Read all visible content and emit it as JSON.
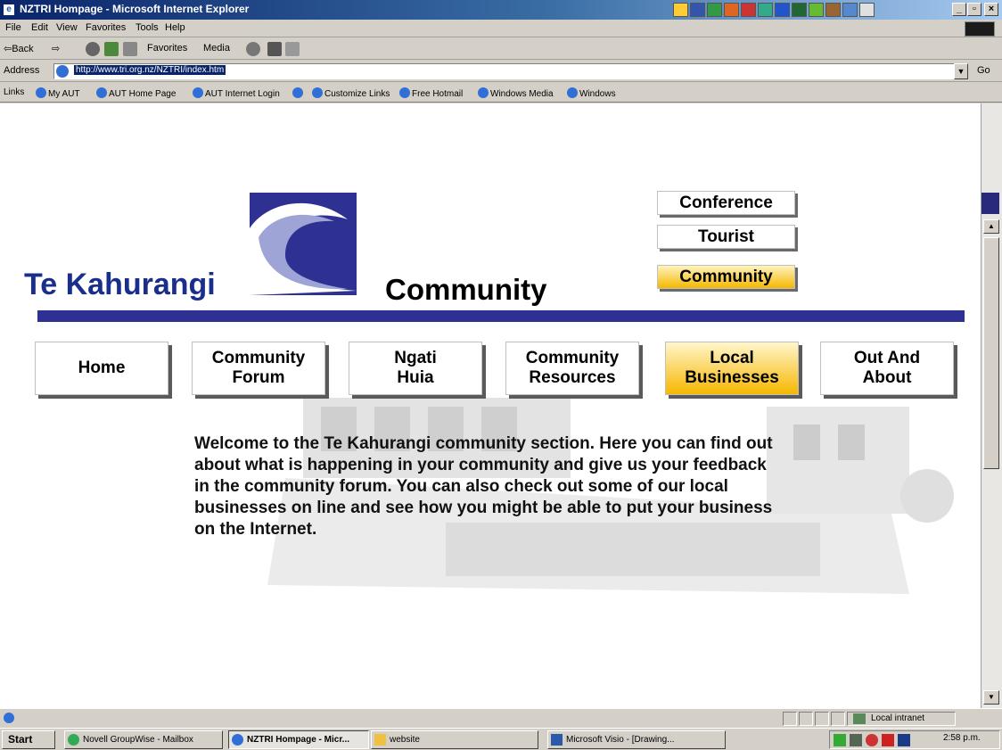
{
  "window": {
    "title": "NZTRI Hompage - Microsoft Internet Explorer",
    "title_icon": "e",
    "minimize": "_",
    "maximize": "▫",
    "close": "×"
  },
  "menu": [
    "File",
    "Edit",
    "View",
    "Favorites",
    "Tools",
    "Help"
  ],
  "toolbar": {
    "back": "⇦Back",
    "forward": "⇨",
    "favorites": "Favorites",
    "media": "Media"
  },
  "address": {
    "label": "Address",
    "url": "http://www.tri.org.nz/NZTRI/index.htm",
    "go": "Go",
    "dropdown": "▼"
  },
  "links": {
    "label": "Links",
    "items": [
      "My AUT",
      "AUT Home Page",
      "AUT Internet Login",
      "Customize Links",
      "Free Hotmail",
      "Windows Media",
      "Windows"
    ]
  },
  "page": {
    "brand": "Te Kahurangi",
    "section_title": "Community",
    "top_nav": [
      {
        "label": "Conference",
        "active": false
      },
      {
        "label": "Tourist",
        "active": false
      },
      {
        "label": "Community",
        "active": true
      }
    ],
    "main_nav": [
      {
        "label": "Home",
        "active": false
      },
      {
        "label": "Community Forum",
        "active": false
      },
      {
        "label": "Ngati Huia",
        "active": false
      },
      {
        "label": "Community Resources",
        "active": false
      },
      {
        "label": "Local Businesses",
        "active": true
      },
      {
        "label": "Out And About",
        "active": false
      }
    ],
    "welcome_text": "Welcome to the Te Kahurangi community section. Here you can find out about what is happening in your community and give us your feedback in the community forum. You can also check out some of our local businesses on  line and see how you might be able to put your business on the Internet."
  },
  "statusbar": {
    "zone": "Local intranet"
  },
  "taskbar": {
    "start": "Start",
    "tasks": [
      "Novell GroupWise - Mailbox",
      "NZTRI Hompage - Micr...",
      "website",
      "Microsoft Visio - [Drawing..."
    ],
    "clock": "2:58 p.m."
  },
  "colors": {
    "brand_blue": "#1a2f8c",
    "divider_blue": "#2e3192",
    "active_gold": "#f5b800"
  }
}
